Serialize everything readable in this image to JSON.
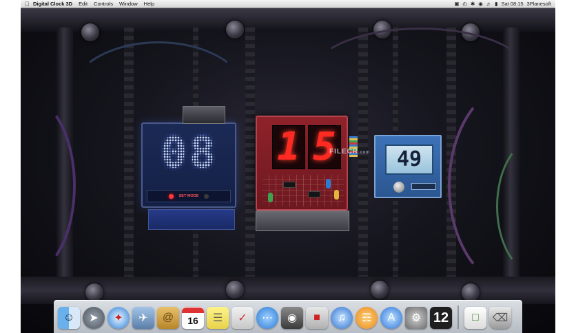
{
  "menubar": {
    "app_name": "Digital Clock 3D",
    "menus": [
      "Edit",
      "Controls",
      "Window",
      "Help"
    ],
    "clock": "Sat 08:15",
    "user": "3Planesoft"
  },
  "clock": {
    "hours": "08",
    "minutes_tens": "1",
    "minutes_ones": "5",
    "seconds": "49",
    "hours_strip_label": "SET MODE"
  },
  "watermark": {
    "text": "FILECR",
    "suffix": ".com"
  },
  "dock": {
    "calendar_day": "16",
    "number_tile": "12"
  },
  "colors": {
    "hours_glow": "#6f94ff",
    "minutes_red": "#ff2a22",
    "seconds_panel": "#3d72b8"
  }
}
